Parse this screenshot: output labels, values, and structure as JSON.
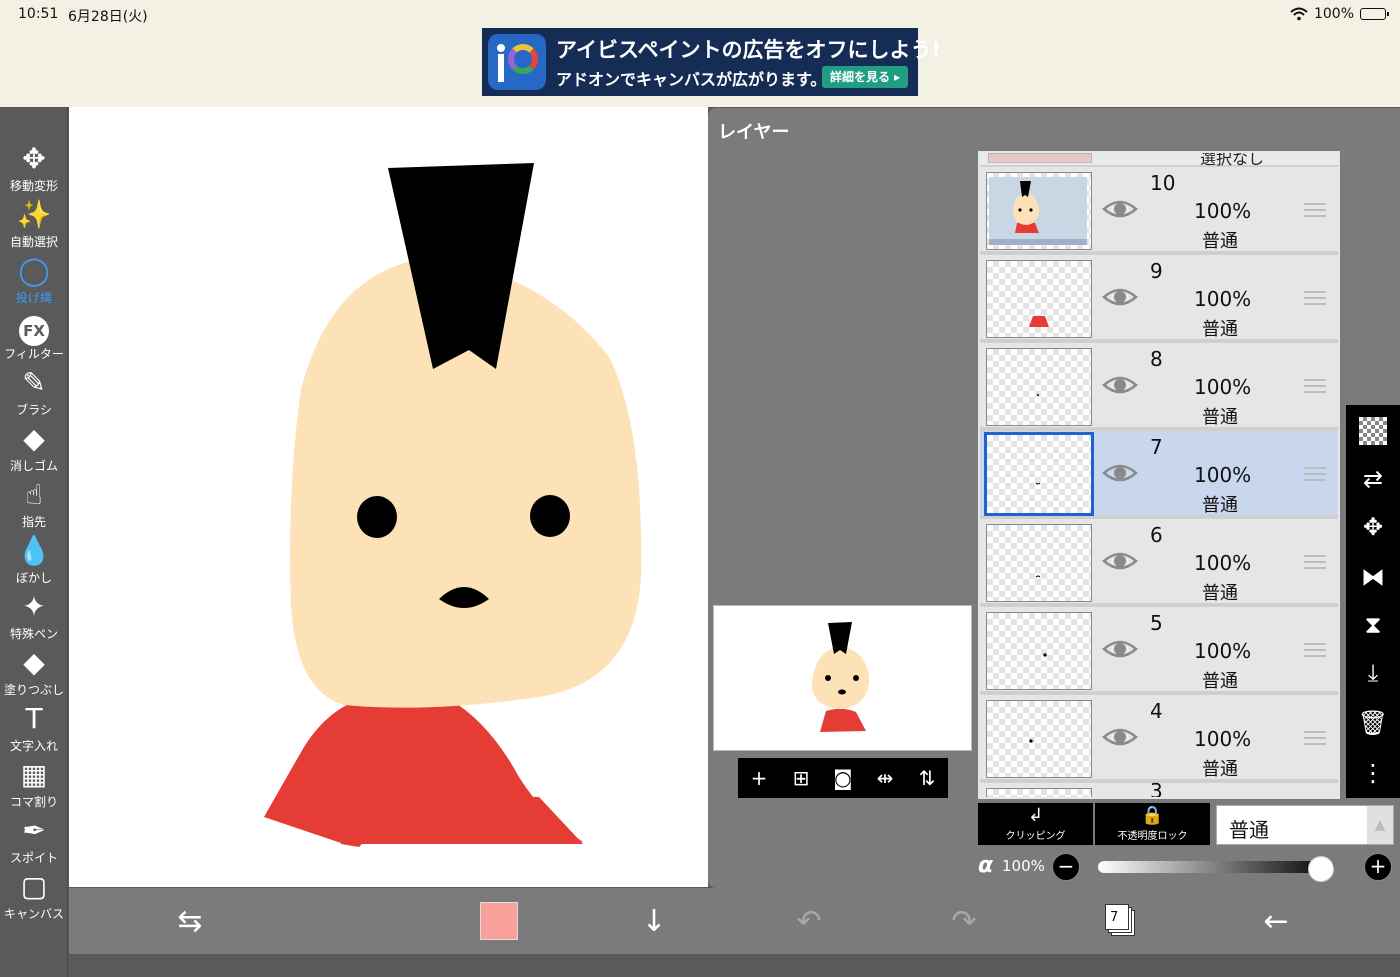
{
  "status": {
    "time": "10:51",
    "date": "6月28日(火)",
    "battery": "100%",
    "battery_level": 1.0
  },
  "ad": {
    "line1": "アイビスペイントの広告をオフにしよう!",
    "line2": "アドオンでキャンバスが広がります。",
    "detail_button": "詳細を見る ▸"
  },
  "toolbar": {
    "tools": [
      {
        "label": "移動変形",
        "icon": "move-transform-icon",
        "glyph": "✥"
      },
      {
        "label": "自動選択",
        "icon": "magic-wand-icon",
        "glyph": "✨"
      },
      {
        "label": "投げ縄",
        "icon": "lasso-icon",
        "glyph": "◯",
        "active": true
      },
      {
        "label": "フィルター",
        "icon": "fx-filter-icon",
        "glyph": "FX"
      },
      {
        "label": "ブラシ",
        "icon": "brush-icon",
        "glyph": "✎"
      },
      {
        "label": "消しゴム",
        "icon": "eraser-icon",
        "glyph": "◆"
      },
      {
        "label": "指先",
        "icon": "smudge-finger-icon",
        "glyph": "☝"
      },
      {
        "label": "ぼかし",
        "icon": "blur-drop-icon",
        "glyph": "💧"
      },
      {
        "label": "特殊ペン",
        "icon": "special-pen-icon",
        "glyph": "✦"
      },
      {
        "label": "塗りつぶし",
        "icon": "fill-bucket-icon",
        "glyph": "◆"
      },
      {
        "label": "文字入れ",
        "icon": "text-icon",
        "glyph": "T"
      },
      {
        "label": "コマ割り",
        "icon": "frame-divider-icon",
        "glyph": "▦"
      },
      {
        "label": "スポイト",
        "icon": "eyedropper-icon",
        "glyph": "✒"
      },
      {
        "label": "キャンバス",
        "icon": "canvas-icon",
        "glyph": "▢"
      }
    ]
  },
  "layer_panel": {
    "title": "レイヤー",
    "top_partial_label": "選択なし",
    "layers": [
      {
        "number": "10",
        "opacity": "100%",
        "mode": "普通",
        "selected": false
      },
      {
        "number": "9",
        "opacity": "100%",
        "mode": "普通",
        "selected": false
      },
      {
        "number": "8",
        "opacity": "100%",
        "mode": "普通",
        "selected": false
      },
      {
        "number": "7",
        "opacity": "100%",
        "mode": "普通",
        "selected": true
      },
      {
        "number": "6",
        "opacity": "100%",
        "mode": "普通",
        "selected": false
      },
      {
        "number": "5",
        "opacity": "100%",
        "mode": "普通",
        "selected": false
      },
      {
        "number": "4",
        "opacity": "100%",
        "mode": "普通",
        "selected": false
      }
    ],
    "bottom_partial_number": "3",
    "clipping_label": "クリッピング",
    "alpha_lock_label": "不透明度ロック",
    "blend_mode": "普通",
    "alpha_symbol": "α",
    "alpha_value": "100%",
    "alpha_level": 1.0
  },
  "bottom_toolbar": {
    "current_color": "#f8a09a",
    "layer_count": "7"
  },
  "colors": {
    "skin": "#fde2b8",
    "hair": "#000000",
    "shirt": "#e53c35",
    "accent_blue": "#3d9cf4",
    "selected_layer": "#c9d7ee"
  }
}
